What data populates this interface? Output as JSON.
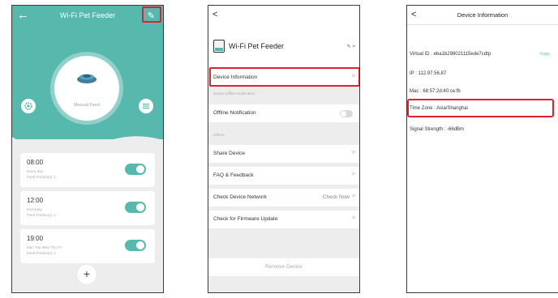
{
  "colors": {
    "accent": "#57b9ad",
    "highlight": "#e0212d",
    "panel_bg": "#ededed"
  },
  "phone1": {
    "title": "Wi-Fi Pet Feeder",
    "manual_feed_label": "Manual Feed",
    "schedules": [
      {
        "time": "08:00",
        "line1": "Every day",
        "line2": "Feed Portion(s): 1"
      },
      {
        "time": "12:00",
        "line1": "Everyday",
        "line2": "Feed Portion(s): 1"
      },
      {
        "time": "19:00",
        "line1": "Mon Tue Wed Thu Fri",
        "line2": "Feed Portion(s): 1"
      }
    ],
    "add_label": "+"
  },
  "phone2": {
    "device_name": "Wi-Fi Pet Feeder",
    "device_information": "Device Information",
    "offline_section": "Device Offline Notification",
    "offline_notification": "Offline Notification",
    "others_section": "Others",
    "share_device": "Share Device",
    "faq_feedback": "FAQ & Feedback",
    "check_network": "Check Device Network",
    "check_now": "Check Now",
    "firmware_update": "Check for Firmware Update",
    "remove_device": "Remove Device"
  },
  "phone3": {
    "title": "Device Information",
    "virtual_id": "Virtual ID : eba1b298021115ede7cdtp",
    "copy_label": "Copy",
    "ip": "IP : 112.97.56.87",
    "mac": "Mac : 68:57:2d:40:ce:fb",
    "time_zone": "Time Zone : Asia/Shanghai",
    "signal_strength": "Signal Strength : -66dBm"
  }
}
